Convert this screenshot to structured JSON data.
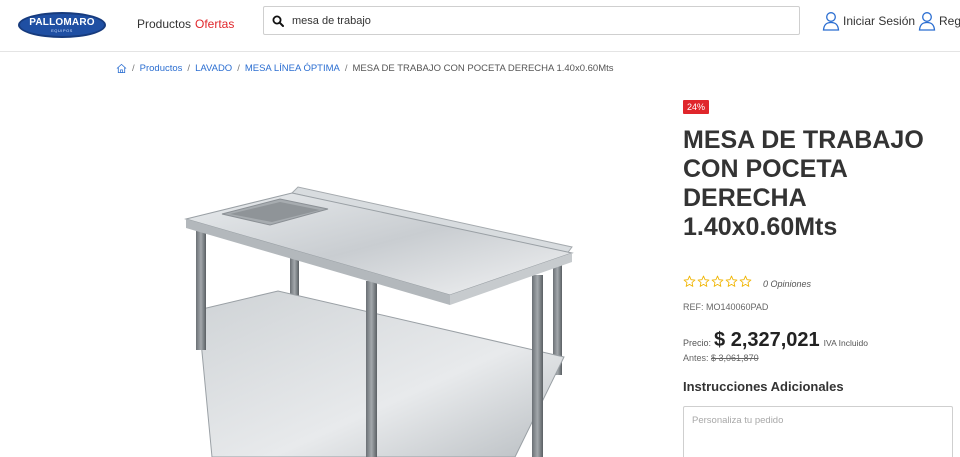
{
  "header": {
    "logo_text": "PALLOMARO",
    "logo_sub": "EQUIPOS",
    "nav": {
      "productos": "Productos",
      "ofertas": "Ofertas"
    },
    "search_value": "mesa de trabajo",
    "login": "Iniciar Sesión",
    "register": "Reg"
  },
  "breadcrumb": {
    "sep": "/",
    "items": [
      "Productos",
      "LAVADO",
      "MESA LÍNEA ÓPTIMA"
    ],
    "current": "MESA DE TRABAJO CON POCETA DERECHA 1.40x0.60Mts"
  },
  "product": {
    "discount_badge": "24%",
    "title": "MESA DE TRABAJO CON POCETA DERECHA 1.40x0.60Mts",
    "rating_value": 0,
    "rating_max": 5,
    "opinions": "0 Opiniones",
    "ref": "REF: MO140060PAD",
    "price_label": "Precio:",
    "price": "$ 2,327,021",
    "iva": "IVA Incluido",
    "before_label": "Antes:",
    "before_price": "$ 3,061,870",
    "instructions_title": "Instrucciones Adicionales",
    "custom_placeholder": "Personaliza tu pedido"
  },
  "colors": {
    "accent_red": "#e0262b",
    "link_blue": "#2b6ed1",
    "star_yellow": "#f0b400",
    "logo_blue": "#1f4fa3"
  },
  "icons": [
    "search-icon",
    "user-icon",
    "home-icon",
    "star-icon"
  ]
}
